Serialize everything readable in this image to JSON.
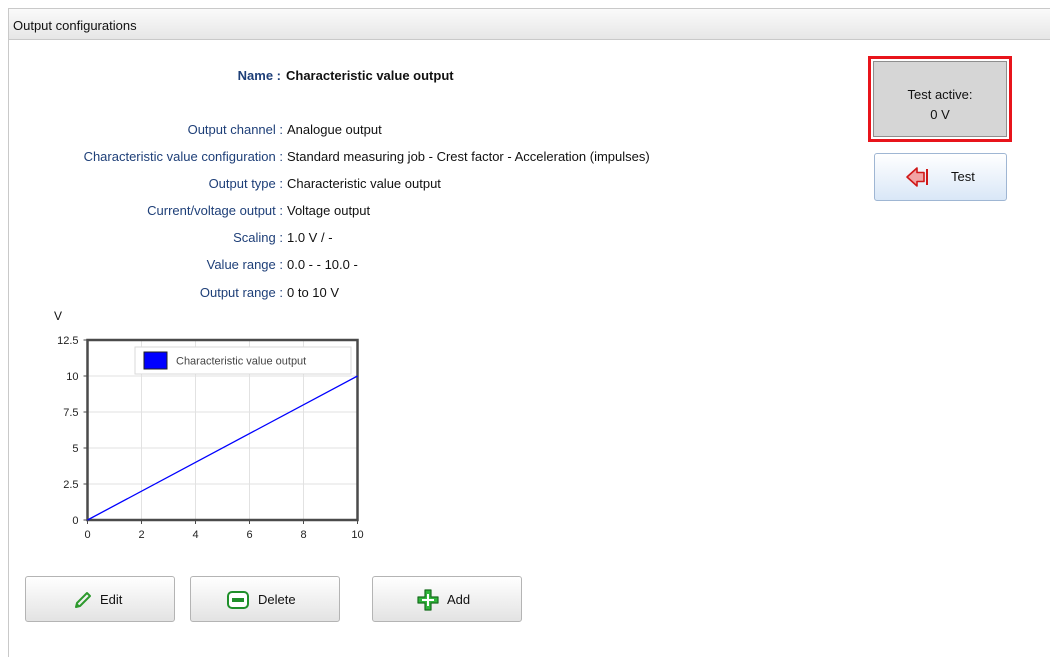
{
  "panel": {
    "title": "Output configurations"
  },
  "details": {
    "name_label": "Name :",
    "name_value": "Characteristic value output",
    "fields": [
      {
        "label": "Output channel :",
        "value": "Analogue output"
      },
      {
        "label": "Characteristic value configuration :",
        "value": "Standard measuring job - Crest factor - Acceleration (impulses)"
      },
      {
        "label": "Output type :",
        "value": "Characteristic value output"
      },
      {
        "label": "Current/voltage output :",
        "value": "Voltage output"
      },
      {
        "label": "Scaling :",
        "value": "1.0 V / -"
      },
      {
        "label": "Value range :",
        "value": "0.0 - - 10.0 -"
      },
      {
        "label": "Output range :",
        "value": "0 to 10 V"
      }
    ]
  },
  "test_status": {
    "line1": "Test active:",
    "line2": "0 V",
    "border_color": "#e8141b"
  },
  "buttons": {
    "test": "Test",
    "edit": "Edit",
    "delete": "Delete",
    "add": "Add"
  },
  "icons": {
    "test": "back-arrow-icon",
    "edit": "pencil-icon",
    "delete": "minus-icon",
    "add": "plus-icon"
  },
  "chart_data": {
    "type": "line",
    "title": "",
    "xlabel": "",
    "ylabel": "V",
    "xlim": [
      0,
      10
    ],
    "ylim": [
      0,
      12.5
    ],
    "x_ticks": [
      "0",
      "2",
      "4",
      "6",
      "8",
      "10"
    ],
    "y_ticks": [
      "0",
      "2.5",
      "5",
      "7.5",
      "10",
      "12.5"
    ],
    "grid": true,
    "legend_position": "top-right",
    "series": [
      {
        "name": "Characteristic value output",
        "color": "#0000ff",
        "x": [
          0,
          10
        ],
        "y": [
          0,
          10
        ]
      }
    ]
  }
}
